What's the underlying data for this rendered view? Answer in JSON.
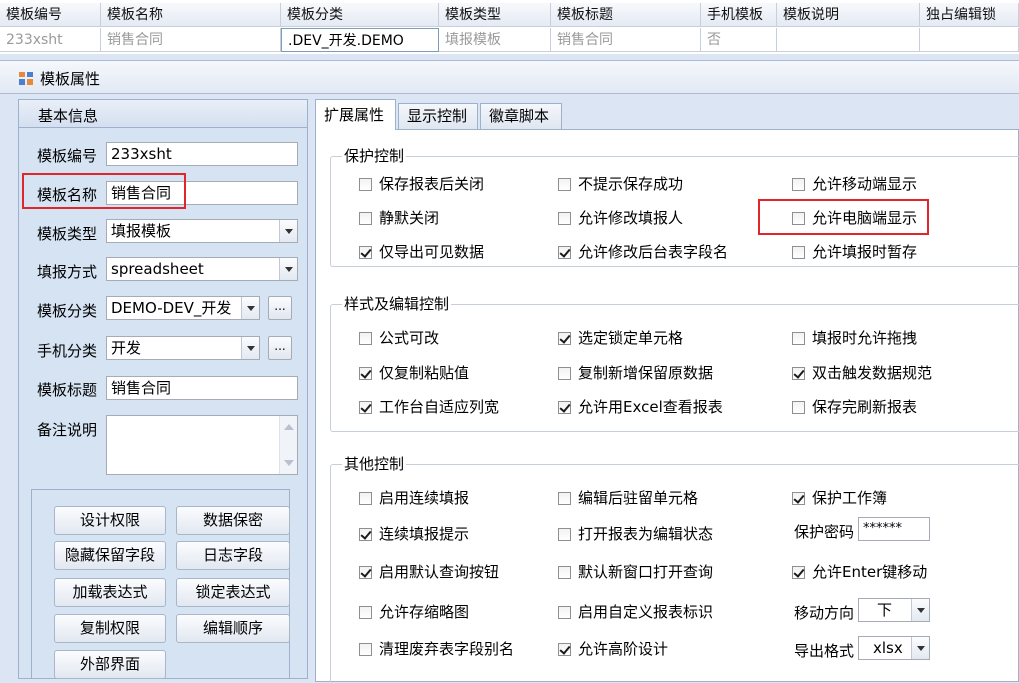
{
  "grid": {
    "headers": [
      "模板编号",
      "模板名称",
      "模板分类",
      "模板类型",
      "模板标题",
      "手机模板",
      "模板说明",
      "独占编辑锁"
    ],
    "row": [
      "233xsht",
      "销售合同",
      ".DEV_开发.DEMO",
      "填报模板",
      "销售合同",
      "否",
      "",
      ""
    ]
  },
  "panel": {
    "title": "模板属性"
  },
  "basic": {
    "section": "基本信息",
    "code_label": "模板编号",
    "code_value": "233xsht",
    "name_label": "模板名称",
    "name_value": "销售合同",
    "type_label": "模板类型",
    "type_value": "填报模板",
    "fill_label": "填报方式",
    "fill_value": "spreadsheet",
    "category_label": "模板分类",
    "category_value": "DEMO-DEV_开发",
    "mobile_cat_label": "手机分类",
    "mobile_cat_value": "开发",
    "title_label": "模板标题",
    "title_value": "销售合同",
    "remark_label": "备注说明",
    "remark_value": "",
    "ellipsis": "..."
  },
  "buttons": [
    "设计权限",
    "数据保密",
    "隐藏保留字段",
    "日志字段",
    "加载表达式",
    "锁定表达式",
    "复制权限",
    "编辑顺序",
    "外部界面"
  ],
  "tabs": [
    "扩展属性",
    "显示控制",
    "徽章脚本"
  ],
  "protect": {
    "title": "保护控制",
    "items": [
      {
        "label": "保存报表后关闭",
        "checked": false
      },
      {
        "label": "不提示保存成功",
        "checked": false
      },
      {
        "label": "允许移动端显示",
        "checked": false
      },
      {
        "label": "静默关闭",
        "checked": false
      },
      {
        "label": "允许修改填报人",
        "checked": false
      },
      {
        "label": "允许电脑端显示",
        "checked": false
      },
      {
        "label": "仅导出可见数据",
        "checked": true
      },
      {
        "label": "允许修改后台表字段名",
        "checked": true
      },
      {
        "label": "允许填报时暂存",
        "checked": false
      }
    ]
  },
  "style": {
    "title": "样式及编辑控制",
    "items": [
      {
        "label": "公式可改",
        "checked": false
      },
      {
        "label": "选定锁定单元格",
        "checked": true
      },
      {
        "label": "填报时允许拖拽",
        "checked": false
      },
      {
        "label": "仅复制粘贴值",
        "checked": true
      },
      {
        "label": "复制新增保留原数据",
        "checked": false
      },
      {
        "label": "双击触发数据规范",
        "checked": true
      },
      {
        "label": "工作台自适应列宽",
        "checked": true
      },
      {
        "label": "允许用Excel查看报表",
        "checked": true
      },
      {
        "label": "保存完刷新报表",
        "checked": false
      }
    ]
  },
  "other": {
    "title": "其他控制",
    "items": [
      {
        "label": "启用连续填报",
        "checked": false
      },
      {
        "label": "编辑后驻留单元格",
        "checked": false
      },
      {
        "label": "保护工作簿",
        "checked": true
      },
      {
        "label": "连续填报提示",
        "checked": true
      },
      {
        "label": "打开报表为编辑状态",
        "checked": false
      },
      {
        "label": "启用默认查询按钮",
        "checked": true
      },
      {
        "label": "默认新窗口打开查询",
        "checked": false
      },
      {
        "label": "允许Enter键移动",
        "checked": true
      },
      {
        "label": "允许存缩略图",
        "checked": false
      },
      {
        "label": "启用自定义报表标识",
        "checked": false
      },
      {
        "label": "清理废弃表字段别名",
        "checked": false
      },
      {
        "label": "允许高阶设计",
        "checked": true
      }
    ],
    "password_label": "保护密码",
    "password_value": "******",
    "direction_label": "移动方向",
    "direction_value": "下",
    "export_label": "导出格式",
    "export_value": "xlsx"
  },
  "colors": {
    "highlight": "#e0262a",
    "panel_bg": "#d6e3f3"
  }
}
